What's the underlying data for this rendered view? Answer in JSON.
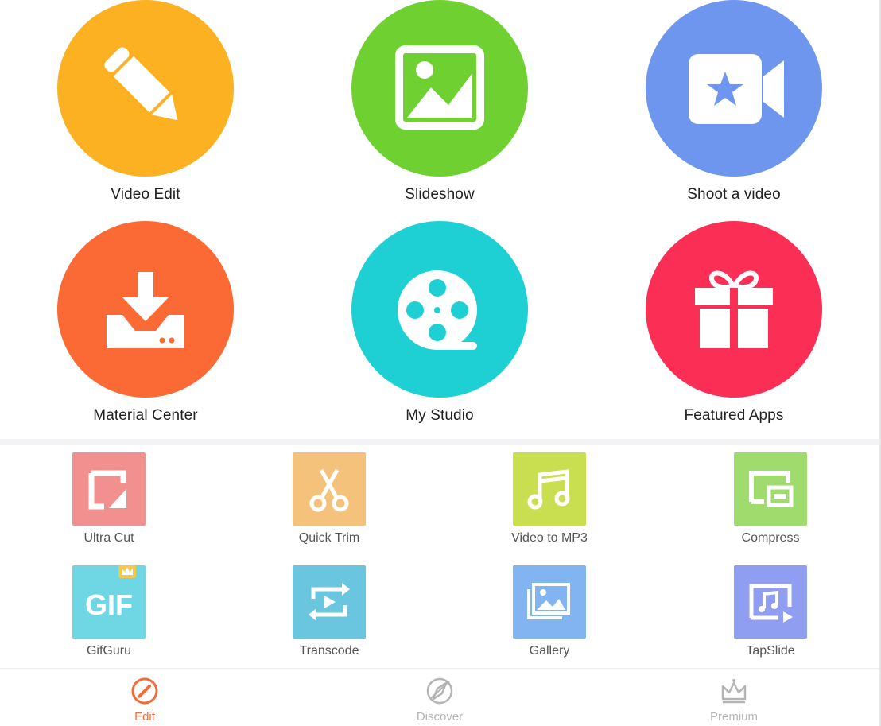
{
  "main_features": [
    {
      "label": "Video Edit",
      "icon": "pencil-icon",
      "color": "#fbb122"
    },
    {
      "label": "Slideshow",
      "icon": "image-icon",
      "color": "#6fd031"
    },
    {
      "label": "Shoot a video",
      "icon": "video-camera-star-icon",
      "color": "#6f96ee"
    },
    {
      "label": "Material Center",
      "icon": "download-tray-icon",
      "color": "#fb6a34"
    },
    {
      "label": "My Studio",
      "icon": "film-reel-icon",
      "color": "#1ed0d4"
    },
    {
      "label": "Featured Apps",
      "icon": "gift-icon",
      "color": "#fb2f55"
    }
  ],
  "tools": [
    {
      "label": "Ultra Cut",
      "icon": "crop-icon",
      "color": "#f28f8f"
    },
    {
      "label": "Quick Trim",
      "icon": "scissors-icon",
      "color": "#f4c27b"
    },
    {
      "label": "Video to MP3",
      "icon": "music-note-icon",
      "color": "#c9df4f"
    },
    {
      "label": "Compress",
      "icon": "compress-icon",
      "color": "#9fdc6d"
    },
    {
      "label": "GifGuru",
      "icon": "gif-icon",
      "color": "#6fd6e3",
      "badge": "crown-badge-icon"
    },
    {
      "label": "Transcode",
      "icon": "transcode-icon",
      "color": "#6ac6df"
    },
    {
      "label": "Gallery",
      "icon": "gallery-icon",
      "color": "#82b4f1"
    },
    {
      "label": "TapSlide",
      "icon": "tapslide-icon",
      "color": "#8f9ef0"
    }
  ],
  "gif_text": "GIF",
  "tabs": [
    {
      "label": "Edit",
      "icon": "edit-circle-icon",
      "active": true
    },
    {
      "label": "Discover",
      "icon": "compass-icon",
      "active": false
    },
    {
      "label": "Premium",
      "icon": "crown-icon",
      "active": false
    }
  ],
  "colors": {
    "active_tab": "#f26b3a",
    "inactive_tab": "#b5b5b5"
  }
}
